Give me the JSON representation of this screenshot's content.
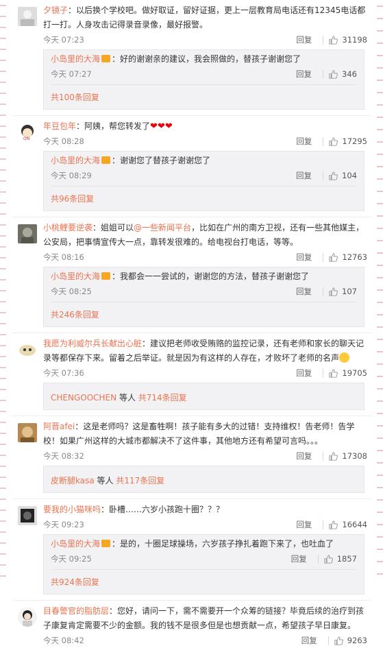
{
  "comments": [
    {
      "user": "夕镜子",
      "sep": "：",
      "text": "以后换个学校吧。做好取证，留好证据，更上一层教育局电话还有12345电话都打一打。人身攻击记得录音录像，最好报警。",
      "time": "今天 07:23",
      "reply": "回复",
      "likes": "31198",
      "sub": {
        "user": "小岛里的大海",
        "text": "：好的谢谢亲的建议，我会照做的，替孩子谢谢您了",
        "time": "今天 07:27",
        "reply": "回复",
        "likes": "346"
      },
      "more": "共100条回复"
    },
    {
      "user": "年豆包年",
      "sep": "：",
      "text": "阿姨，帮您转发了",
      "time": "今天 08:28",
      "reply": "回复",
      "likes": "17295",
      "sub": {
        "user": "小岛里的大海",
        "text": "：谢谢您了替孩子谢谢您了",
        "time": "今天 08:29",
        "reply": "回复",
        "likes": "104"
      },
      "more": "共96条回复"
    },
    {
      "user": "小桃鲤要逆袭",
      "sep": "：",
      "text_a": "姐姐可以",
      "mention": "@一些新闻平台",
      "text_b": "，比如在广州的南方卫视，还有一些其他媒主，公安局，把事情宣传大一点，靠转发很难的。给电视台打电话，等等。",
      "time": "今天 08:16",
      "reply": "回复",
      "likes": "12763",
      "sub": {
        "user": "小岛里的大海",
        "text": "：我都会一一尝试的，谢谢您的方法，替孩子谢谢您了",
        "time": "今天 08:25",
        "reply": "回复",
        "likes": "107"
      },
      "more": "共246条回复"
    },
    {
      "user": "我愿为利威尔兵长献出心脏",
      "sep": "：",
      "text": "建议把老师收受贿赂的监控记录，还有老师和家长的聊天记录等都保存下来。留着之后举证。就是因为有这样的人存在，才败坏了老师的名声",
      "time": "今天 07:36",
      "reply": "回复",
      "likes": "19705",
      "more_name": "CHENGOOCHEN",
      "more_mid": " 等人 ",
      "more": "共714条回复"
    },
    {
      "user": "阿晋afei",
      "sep": "：",
      "text": "这是老师吗？这是畜牲啊！孩子能有多大的过错！支持维权！告老师！告学校！如果广州这样的大城市都解决不了这件事，其他地方还有希望可言吗。。。",
      "time": "今天 08:32",
      "reply": "回复",
      "likes": "17308",
      "more_name": "皮断腿kasa",
      "more_mid": " 等人 ",
      "more": "共117条回复"
    },
    {
      "user": "要我的小猫咪吗",
      "sep": "：",
      "text": "卧槽……六岁小孩跑十圈？？？",
      "time": "今天 09:23",
      "reply": "回复",
      "likes": "16644",
      "sub": {
        "user": "小岛里的大海",
        "text": "：是的，十圈足球操场，六岁孩子挣扎着跑下来了，也吐血了",
        "time": "今天 09:25",
        "reply": "回复",
        "likes": "1857"
      },
      "more": "共924条回复"
    },
    {
      "user": "目春警官的脂肪层",
      "sep": "：",
      "text": "您好，请问一下，需不需要开一个众筹的链接？毕竟后续的治疗到孩子康复肯定需要不少的金额。我的钱不是很多但是也想贡献一点，希望孩子早日康复。",
      "time": "今天 08:42",
      "reply": "回复",
      "likes": "9263"
    }
  ],
  "icons": {
    "like": "thumb-up-icon",
    "vip": "vip-badge-icon",
    "heart": "heart-emoji",
    "emoji": "face-emoji"
  },
  "colors": {
    "username": "#eb7350",
    "accent": "#eb7350",
    "subbox": "#f2f2f5"
  }
}
